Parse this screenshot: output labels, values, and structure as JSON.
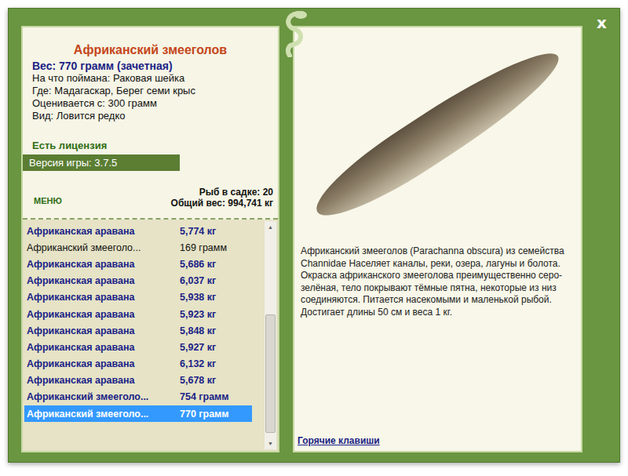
{
  "window": {
    "close": "x"
  },
  "fish": {
    "title": "Африканский змееголов",
    "weight": "Вес: 770 грамм (зачетная)",
    "details": [
      "На что поймана: Раковая шейка",
      "Где: Мадагаскар, Берег семи крыс",
      "Оценивается с: 300 грамм",
      "Вид: Ловится редко"
    ],
    "description": "Африканский змееголов (Parachanna obscura) из семейства Channidae Населяет каналы, реки, озера, лагуны и болота. Окраска африканского змееголова преимущественно серо-зелёная, тело покрывают тёмные пятна, некоторые из низ соединяются. Питается насекомыми и маленькой рыбой. Достигает длины 50 см и веса 1 кг."
  },
  "license": "Есть лицензия",
  "version": "Версия игры: 3.7.5",
  "menu": "МЕНЮ",
  "keep_net": {
    "count": "Рыб в садке: 20",
    "total": "Общий вес: 994,741 кг"
  },
  "catch_list": [
    {
      "name": "Африканская аравана",
      "weight": "5,774 кг",
      "trophy": true,
      "selected": false
    },
    {
      "name": "Африканский змееголо...",
      "weight": "169 грамм",
      "trophy": false,
      "selected": false
    },
    {
      "name": "Африканская аравана",
      "weight": "5,686 кг",
      "trophy": true,
      "selected": false
    },
    {
      "name": "Африканская аравана",
      "weight": "6,037 кг",
      "trophy": true,
      "selected": false
    },
    {
      "name": "Африканская аравана",
      "weight": "5,938 кг",
      "trophy": true,
      "selected": false
    },
    {
      "name": "Африканская аравана",
      "weight": "5,923 кг",
      "trophy": true,
      "selected": false
    },
    {
      "name": "Африканская аравана",
      "weight": "5,848 кг",
      "trophy": true,
      "selected": false
    },
    {
      "name": "Африканская аравана",
      "weight": "5,927 кг",
      "trophy": true,
      "selected": false
    },
    {
      "name": "Африканская аравана",
      "weight": "6,132 кг",
      "trophy": true,
      "selected": false
    },
    {
      "name": "Африканская аравана",
      "weight": "5,678 кг",
      "trophy": true,
      "selected": false
    },
    {
      "name": "Африканский змееголо...",
      "weight": "754 грамм",
      "trophy": true,
      "selected": false
    },
    {
      "name": "Африканский змееголо...",
      "weight": "770 грамм",
      "trophy": true,
      "selected": true
    }
  ],
  "scrollbar": {
    "thumb_start": 0.4,
    "thumb_size": 0.57
  },
  "hotkeys": "Горячие клавиши"
}
